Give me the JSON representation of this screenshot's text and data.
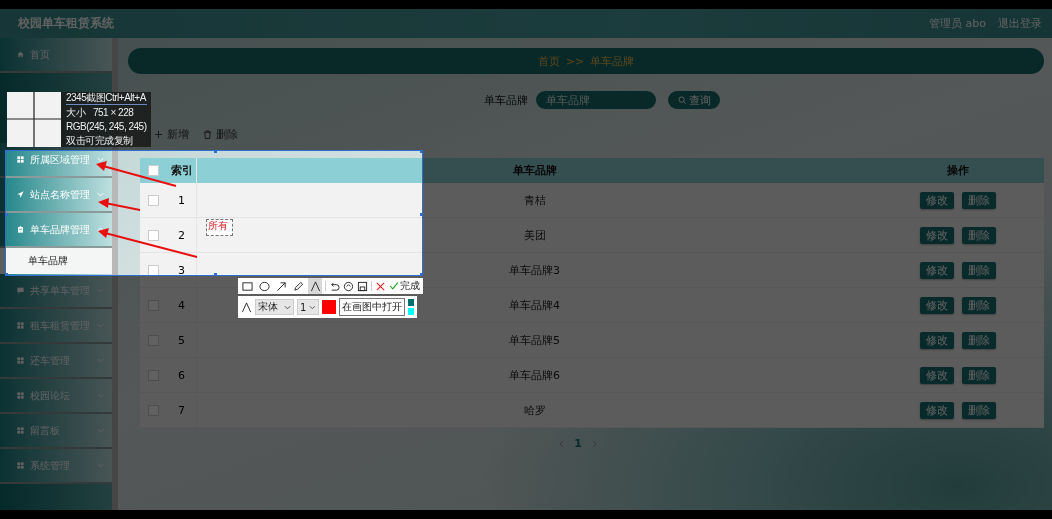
{
  "header": {
    "title": "校园单车租赁系统",
    "user": "管理员 abo",
    "logout": "退出登录"
  },
  "sidebar": {
    "items": [
      {
        "label": "首页"
      },
      {
        "label": "所属区域管理",
        "expanded": false
      },
      {
        "label": "站点名称管理",
        "expanded": false
      },
      {
        "label": "单车品牌管理",
        "expanded": true,
        "children": [
          {
            "label": "单车品牌",
            "selected": true
          }
        ]
      },
      {
        "label": "共享单车管理",
        "expanded": false
      },
      {
        "label": "租车租赁管理",
        "expanded": false
      },
      {
        "label": "还车管理",
        "expanded": false
      },
      {
        "label": "校园论坛",
        "expanded": false
      },
      {
        "label": "留言板",
        "expanded": false
      },
      {
        "label": "系统管理",
        "expanded": false
      }
    ]
  },
  "breadcrumb": {
    "home": "首页",
    "separator": ">>",
    "current": "单车品牌"
  },
  "search": {
    "label": "单车品牌",
    "placeholder": "单车品牌",
    "button": "查询"
  },
  "actions": {
    "add": "新增",
    "delete": "删除"
  },
  "table": {
    "select_all_checked": false,
    "columns": {
      "index": "索引",
      "brand": "单车品牌",
      "actions": "操作"
    },
    "rows": [
      {
        "checked": false,
        "index": "1",
        "brand": "青桔",
        "edit": "修改",
        "delete": "删除"
      },
      {
        "checked": false,
        "index": "2",
        "brand": "美团",
        "edit": "修改",
        "delete": "删除"
      },
      {
        "checked": false,
        "index": "3",
        "brand": "单车品牌3",
        "edit": "修改",
        "delete": "删除"
      },
      {
        "checked": false,
        "index": "4",
        "brand": "单车品牌4",
        "edit": "修改",
        "delete": "删除"
      },
      {
        "checked": false,
        "index": "5",
        "brand": "单车品牌5",
        "edit": "修改",
        "delete": "删除"
      },
      {
        "checked": false,
        "index": "6",
        "brand": "单车品牌6",
        "edit": "修改",
        "delete": "删除"
      },
      {
        "checked": false,
        "index": "7",
        "brand": "哈罗",
        "edit": "修改",
        "delete": "删除"
      }
    ]
  },
  "pagination": {
    "page": "1"
  },
  "capture_tool": {
    "magnifier": {
      "title": "2345截图Ctrl+Alt+A",
      "size_label": "大小",
      "size": "751 × 228",
      "rgb": "RGB(245, 245, 245)",
      "hint": "双击可完成复制"
    },
    "annotation_text": "所有",
    "tools": [
      {
        "kind": "rect",
        "selected": false
      },
      {
        "kind": "ellipse",
        "selected": false
      },
      {
        "kind": "arrow",
        "selected": false
      },
      {
        "kind": "pen",
        "selected": false
      },
      {
        "kind": "text",
        "selected": true
      }
    ],
    "done": "完成",
    "font": "宋体",
    "font_size": "1",
    "tooltip": "在画图中打开",
    "palette": [
      {
        "color": "#007070"
      },
      {
        "color": "#00ffff"
      }
    ]
  }
}
